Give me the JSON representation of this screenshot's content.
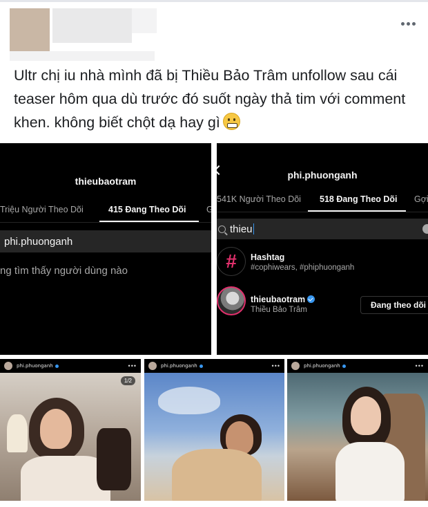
{
  "post": {
    "text": "Ultr chị iu nhà mình đã bị Thiều Bảo Trâm unfollow sau cái teaser hôm qua dù trước đó suốt ngày thả tim với comment khen. không biết chột dạ hay gì"
  },
  "left_screen": {
    "username": "thieubaotram",
    "tab_followers": "Triệu Người Theo Dõi",
    "tab_following": "415 Đang Theo Dõi",
    "tab_more": "G",
    "search_value": "phi.phuonganh",
    "empty_result": "ng tìm thấy người dùng nào"
  },
  "right_screen": {
    "username": "phi.phuonganh",
    "tab_followers": "541K Người Theo Dõi",
    "tab_following": "518 Đang Theo Dõi",
    "tab_more": "Gợi",
    "search_value": "thieu",
    "results": [
      {
        "title": "Hashtag",
        "subtitle": "#cophiwears, #phiphuonganh"
      },
      {
        "title": "thieubaotram",
        "subtitle": "Thiều Bảo Trâm",
        "button": "Đang theo dõi"
      }
    ]
  },
  "thumbnails": [
    {
      "account": "phi.phuonganh",
      "counter": "1/2"
    },
    {
      "account": "phi.phuonganh"
    },
    {
      "account": "phi.phuonganh"
    }
  ],
  "colors": {
    "instagram_black": "#000000",
    "verified_blue": "#3897f0",
    "text_primary": "#1c1e21"
  }
}
